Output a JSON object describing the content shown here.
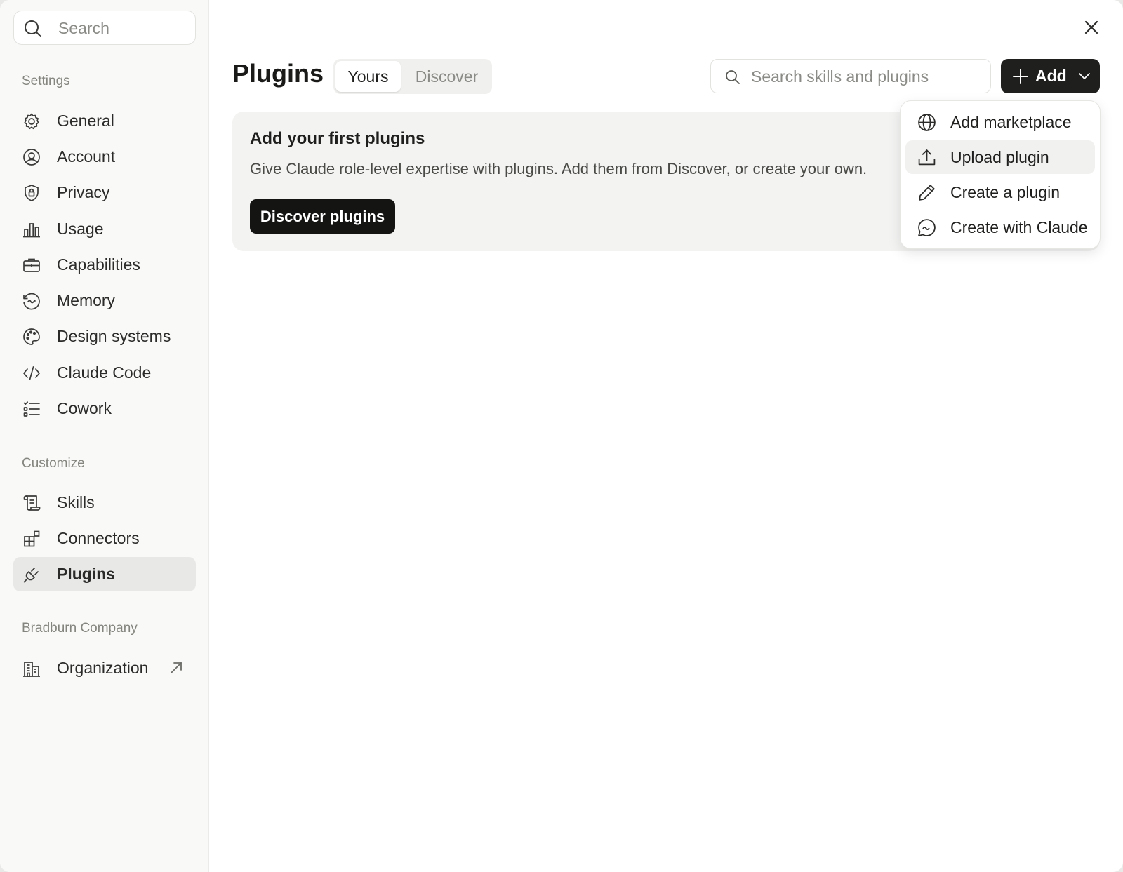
{
  "sidebar": {
    "search_placeholder": "Search",
    "sections": [
      {
        "label": "Settings",
        "items": [
          {
            "label": "General",
            "icon": "gear-icon"
          },
          {
            "label": "Account",
            "icon": "user-circle-icon"
          },
          {
            "label": "Privacy",
            "icon": "shield-lock-icon"
          },
          {
            "label": "Usage",
            "icon": "bar-chart-icon"
          },
          {
            "label": "Capabilities",
            "icon": "briefcase-icon"
          },
          {
            "label": "Memory",
            "icon": "memory-icon"
          },
          {
            "label": "Design systems",
            "icon": "palette-icon"
          },
          {
            "label": "Claude Code",
            "icon": "code-icon"
          },
          {
            "label": "Cowork",
            "icon": "checklist-icon"
          }
        ]
      },
      {
        "label": "Customize",
        "items": [
          {
            "label": "Skills",
            "icon": "scroll-icon"
          },
          {
            "label": "Connectors",
            "icon": "grid-plus-icon"
          },
          {
            "label": "Plugins",
            "icon": "plug-icon",
            "active": true
          }
        ]
      },
      {
        "label": "Bradburn Company",
        "items": [
          {
            "label": "Organization",
            "icon": "building-icon",
            "external": true
          }
        ]
      }
    ]
  },
  "header": {
    "title": "Plugins",
    "tabs": [
      {
        "label": "Yours",
        "selected": true
      },
      {
        "label": "Discover",
        "selected": false
      }
    ],
    "search_placeholder": "Search skills and plugins",
    "add_label": "Add"
  },
  "card": {
    "title": "Add your first plugins",
    "text": "Give Claude role-level expertise with plugins. Add them from Discover, or create your own.",
    "button_label": "Discover plugins"
  },
  "add_menu": {
    "items": [
      {
        "label": "Add marketplace",
        "icon": "globe-icon"
      },
      {
        "label": "Upload plugin",
        "icon": "upload-icon",
        "highlighted": true
      },
      {
        "label": "Create a plugin",
        "icon": "pencil-icon"
      },
      {
        "label": "Create with Claude",
        "icon": "chat-bubble-icon"
      }
    ]
  },
  "colors": {
    "primary_button": "#1f1f1e",
    "sidebar_bg": "#f9f9f8",
    "active_item_bg": "#e8e8e6",
    "card_bg": "#f3f3f2"
  }
}
